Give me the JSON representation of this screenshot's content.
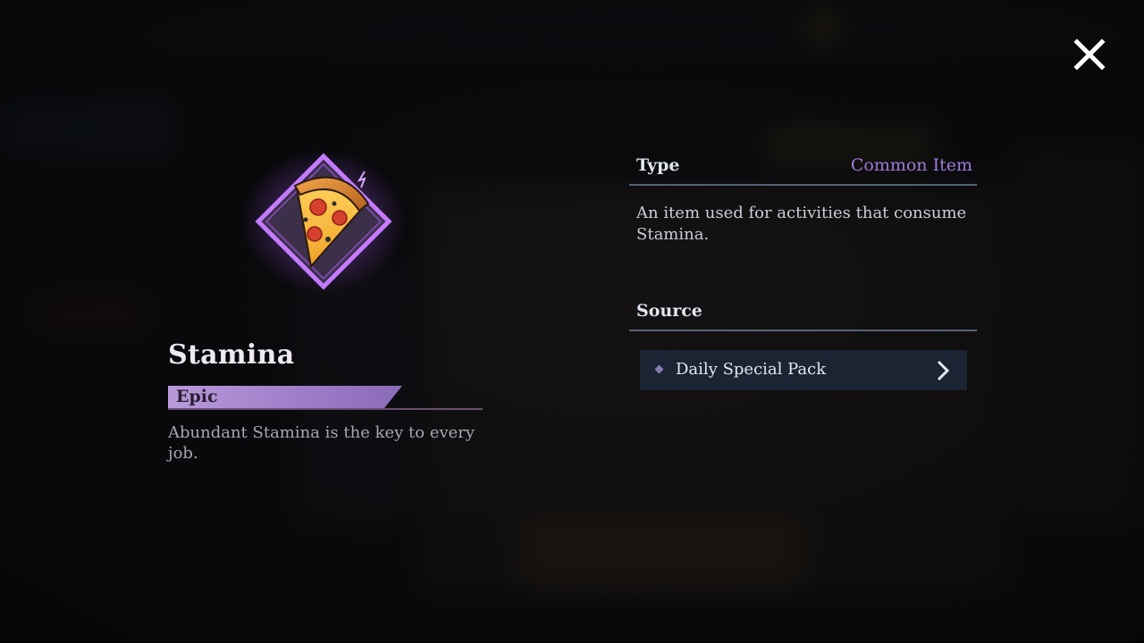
{
  "dialog": {
    "close_icon": "close-icon"
  },
  "item": {
    "name": "Stamina",
    "rarity": "Epic",
    "description": "Abundant Stamina is the key to every job.",
    "icon": "pizza-slice-icon"
  },
  "details": {
    "type_title": "Type",
    "type_value": "Common Item",
    "type_description": "An item used for activities that consume Stamina.",
    "source_title": "Source",
    "sources": [
      {
        "label": "Daily Special Pack",
        "icon": "chevron-right-icon"
      }
    ]
  },
  "colors": {
    "rarity_epic": "#9c7cc7",
    "type_value": "#a07ad8",
    "source_row_bg": "#1b2432",
    "divider": "#566377"
  }
}
